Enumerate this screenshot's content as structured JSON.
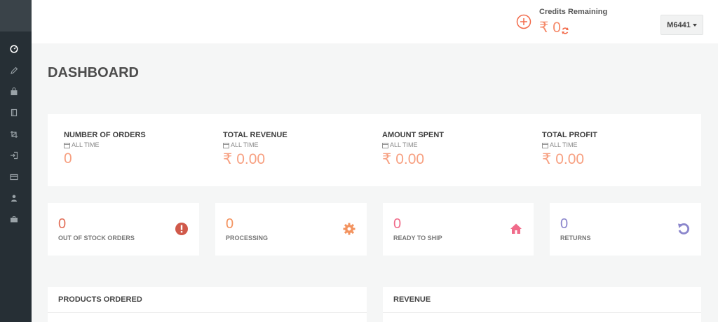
{
  "header": {
    "credits_label": "Credits Remaining",
    "credits_value": "₹ 0",
    "user_label": "M6441"
  },
  "sidebar": {
    "icons": [
      "dashboard-icon",
      "pencil-icon",
      "bag-icon",
      "book-icon",
      "crop-icon",
      "sign-in-icon",
      "credit-card-icon",
      "user-icon",
      "briefcase-icon"
    ]
  },
  "page": {
    "title": "DASHBOARD"
  },
  "stats": [
    {
      "label": "NUMBER OF ORDERS",
      "period": "ALL TIME",
      "value": "0"
    },
    {
      "label": "TOTAL REVENUE",
      "period": "ALL TIME",
      "value": "₹ 0.00"
    },
    {
      "label": "AMOUNT SPENT",
      "period": "ALL TIME",
      "value": "₹ 0.00"
    },
    {
      "label": "TOTAL PROFIT",
      "period": "ALL TIME",
      "value": "₹ 0.00"
    }
  ],
  "status_cards": [
    {
      "value": "0",
      "label": "OUT OF STOCK ORDERS",
      "icon": "exclamation-circle-icon",
      "color": "#e2705a"
    },
    {
      "value": "0",
      "label": "PROCESSING",
      "icon": "gear-icon",
      "color": "#f3935f"
    },
    {
      "value": "0",
      "label": "READY TO SHIP",
      "icon": "home-icon",
      "color": "#f06b8a"
    },
    {
      "value": "0",
      "label": "RETURNS",
      "icon": "undo-icon",
      "color": "#8b86cc"
    }
  ],
  "panels": [
    {
      "title": "PRODUCTS ORDERED"
    },
    {
      "title": "REVENUE"
    }
  ]
}
